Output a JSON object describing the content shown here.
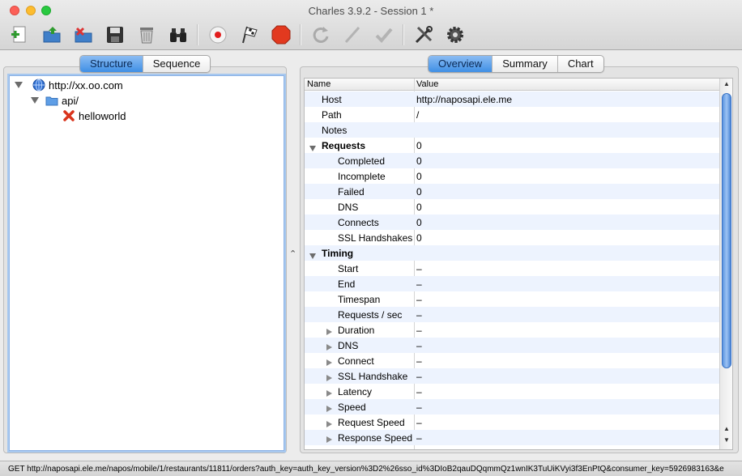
{
  "window": {
    "title": "Charles 3.9.2 - Session 1 *"
  },
  "toolbar": {
    "icons": [
      "new-session-icon",
      "open-session-icon",
      "close-session-icon",
      "save-icon",
      "trash-icon",
      "binoculars-icon",
      "record-icon",
      "throttle-flag-icon",
      "stop-icon",
      "repeat-icon",
      "edit-icon",
      "validate-check-icon",
      "tools-icon",
      "settings-gear-icon"
    ]
  },
  "left": {
    "tabs": [
      {
        "label": "Structure",
        "active": true
      },
      {
        "label": "Sequence",
        "active": false
      }
    ],
    "tree": {
      "host": "http://xx.oo.com",
      "folder": "api/",
      "item": "helloworld"
    }
  },
  "right": {
    "tabs": [
      {
        "label": "Overview",
        "active": true
      },
      {
        "label": "Summary",
        "active": false
      },
      {
        "label": "Chart",
        "active": false
      }
    ],
    "columns": {
      "name": "Name",
      "value": "Value"
    },
    "rows": [
      {
        "name": "Host",
        "value": "http://naposapi.ele.me",
        "indent": 1,
        "kind": "plain"
      },
      {
        "name": "Path",
        "value": "/",
        "indent": 1,
        "kind": "plain"
      },
      {
        "name": "Notes",
        "value": "",
        "indent": 1,
        "kind": "plain"
      },
      {
        "name": "Requests",
        "value": "0",
        "indent": 0,
        "kind": "group"
      },
      {
        "name": "Completed",
        "value": "0",
        "indent": 2,
        "kind": "plain"
      },
      {
        "name": "Incomplete",
        "value": "0",
        "indent": 2,
        "kind": "plain"
      },
      {
        "name": "Failed",
        "value": "0",
        "indent": 2,
        "kind": "plain"
      },
      {
        "name": "DNS",
        "value": "0",
        "indent": 2,
        "kind": "plain"
      },
      {
        "name": "Connects",
        "value": "0",
        "indent": 2,
        "kind": "plain"
      },
      {
        "name": "SSL Handshakes",
        "value": "0",
        "indent": 2,
        "kind": "plain"
      },
      {
        "name": "Timing",
        "value": "",
        "indent": 0,
        "kind": "group"
      },
      {
        "name": "Start",
        "value": "–",
        "indent": 2,
        "kind": "plain"
      },
      {
        "name": "End",
        "value": "–",
        "indent": 2,
        "kind": "plain"
      },
      {
        "name": "Timespan",
        "value": "–",
        "indent": 2,
        "kind": "plain"
      },
      {
        "name": "Requests / sec",
        "value": "–",
        "indent": 2,
        "kind": "plain"
      },
      {
        "name": "Duration",
        "value": "–",
        "indent": 2,
        "kind": "sub"
      },
      {
        "name": "DNS",
        "value": "–",
        "indent": 2,
        "kind": "sub"
      },
      {
        "name": "Connect",
        "value": "–",
        "indent": 2,
        "kind": "sub"
      },
      {
        "name": "SSL Handshake",
        "value": "–",
        "indent": 2,
        "kind": "sub"
      },
      {
        "name": "Latency",
        "value": "–",
        "indent": 2,
        "kind": "sub"
      },
      {
        "name": "Speed",
        "value": "–",
        "indent": 2,
        "kind": "sub"
      },
      {
        "name": "Request Speed",
        "value": "–",
        "indent": 2,
        "kind": "sub"
      },
      {
        "name": "Response Speed",
        "value": "–",
        "indent": 2,
        "kind": "sub"
      }
    ]
  },
  "status": {
    "text": "GET http://naposapi.ele.me/napos/mobile/1/restaurants/11811/orders?auth_key=auth_key_version%3D2%26sso_id%3DIoB2qauDQqmmQz1wnIK3TuUiKVyi3f3EnPtQ&consumer_key=5926983163&e"
  },
  "colors": {
    "accent": "#3f8fe5",
    "stripe": "#edf3fe",
    "row_text": "#000000"
  }
}
